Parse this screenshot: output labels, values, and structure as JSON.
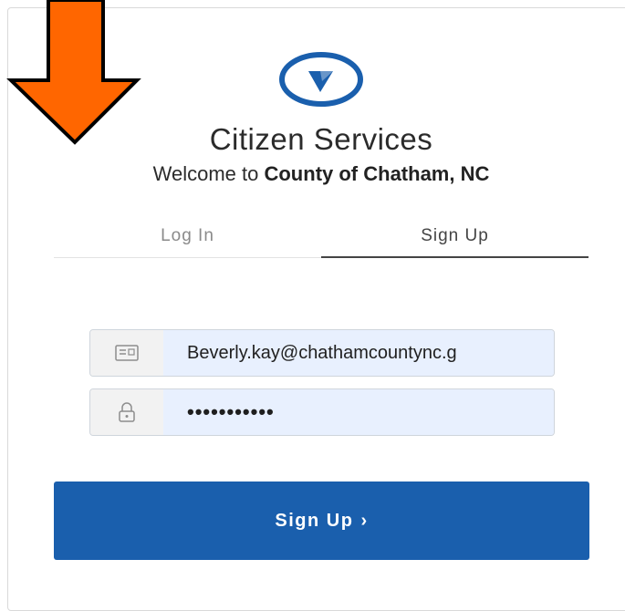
{
  "header": {
    "title": "Citizen Services",
    "welcome_prefix": "Welcome to ",
    "org_name": "County of Chatham, NC"
  },
  "tabs": [
    {
      "label": "Log In",
      "active": false
    },
    {
      "label": "Sign Up",
      "active": true
    }
  ],
  "form": {
    "email_value": "Beverly.kay@chathamcountync.g",
    "password_value": "•••••••••••"
  },
  "submit": {
    "label": "Sign Up",
    "chevron": "›"
  },
  "colors": {
    "arrow": "#ff6600",
    "brand_blue": "#1a5fad",
    "autofill_bg": "#e8f0fe"
  },
  "icons": [
    "down-arrow-annotation",
    "logo-send-icon",
    "email-card-icon",
    "lock-icon",
    "chevron-right-icon"
  ]
}
